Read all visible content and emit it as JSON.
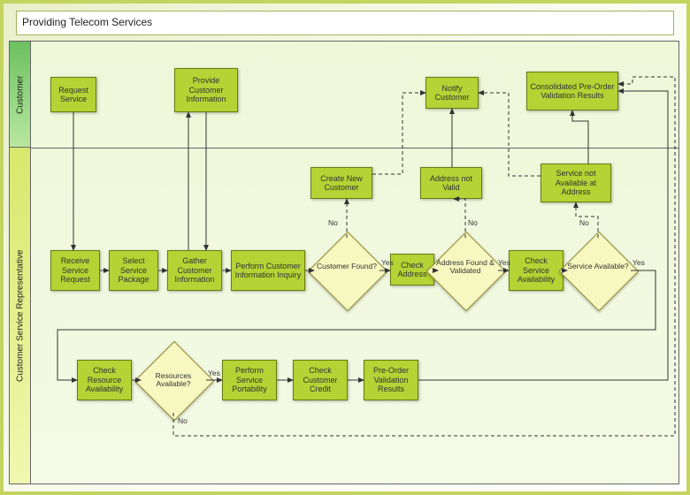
{
  "title": "Providing Telecom Services",
  "lanes": {
    "customer": "Customer",
    "csr": "Customer Service Representative"
  },
  "nodes": {
    "request_service": "Request\nService",
    "provide_ci": "Provide\nCustomer\nInformation",
    "notify_customer": "Notify\nCustomer",
    "consolidated": "Consolidated\nPre-Order\nValidation Results",
    "receive_sr": "Receive\nService\nRequest",
    "select_sp": "Select\nService\nPackage",
    "gather_ci": "Gather\nCustomer\nInformation",
    "perform_cii": "Perform Customer\nInformation\nInquiry",
    "create_nc": "Create New\nCustomer",
    "check_addr": "Check\nAddress",
    "addr_nv": "Address not\nValid",
    "check_sa": "Check\nService\nAvailability",
    "svc_na": "Service not\nAvailable at\nAddress",
    "check_ra": "Check\nResource\nAvailability",
    "perform_sp": "Perform\nService\nPortability",
    "check_cc": "Check\nCustomer\nCredit",
    "preorder_vr": "Pre-Order\nValidation\nResults"
  },
  "decisions": {
    "cust_found": "Customer\nFound?",
    "addr_fv": "Address\nFound &\nValidated",
    "svc_avail": "Service\nAvailable?",
    "res_avail": "Resources\nAvailable?"
  },
  "edge_labels": {
    "yes": "Yes",
    "no": "No"
  },
  "chart_data": {
    "type": "swimlane-flowchart",
    "title": "Providing Telecom Services",
    "lanes": [
      "Customer",
      "Customer Service Representative"
    ],
    "nodes": [
      {
        "id": "request_service",
        "lane": "Customer",
        "type": "process",
        "label": "Request Service"
      },
      {
        "id": "provide_ci",
        "lane": "Customer",
        "type": "process",
        "label": "Provide Customer Information"
      },
      {
        "id": "notify_customer",
        "lane": "Customer",
        "type": "process",
        "label": "Notify Customer"
      },
      {
        "id": "consolidated",
        "lane": "Customer",
        "type": "process",
        "label": "Consolidated Pre-Order Validation Results"
      },
      {
        "id": "receive_sr",
        "lane": "Customer Service Representative",
        "type": "process",
        "label": "Receive Service Request"
      },
      {
        "id": "select_sp",
        "lane": "Customer Service Representative",
        "type": "process",
        "label": "Select Service Package"
      },
      {
        "id": "gather_ci",
        "lane": "Customer Service Representative",
        "type": "process",
        "label": "Gather Customer Information"
      },
      {
        "id": "perform_cii",
        "lane": "Customer Service Representative",
        "type": "process",
        "label": "Perform Customer Information Inquiry"
      },
      {
        "id": "cust_found",
        "lane": "Customer Service Representative",
        "type": "decision",
        "label": "Customer Found?"
      },
      {
        "id": "create_nc",
        "lane": "Customer Service Representative",
        "type": "process",
        "label": "Create New Customer"
      },
      {
        "id": "check_addr",
        "lane": "Customer Service Representative",
        "type": "process",
        "label": "Check Address"
      },
      {
        "id": "addr_fv",
        "lane": "Customer Service Representative",
        "type": "decision",
        "label": "Address Found & Validated"
      },
      {
        "id": "addr_nv",
        "lane": "Customer Service Representative",
        "type": "process",
        "label": "Address not Valid"
      },
      {
        "id": "check_sa",
        "lane": "Customer Service Representative",
        "type": "process",
        "label": "Check Service Availability"
      },
      {
        "id": "svc_avail",
        "lane": "Customer Service Representative",
        "type": "decision",
        "label": "Service Available?"
      },
      {
        "id": "svc_na",
        "lane": "Customer Service Representative",
        "type": "process",
        "label": "Service not Available at Address"
      },
      {
        "id": "check_ra",
        "lane": "Customer Service Representative",
        "type": "process",
        "label": "Check Resource Availability"
      },
      {
        "id": "res_avail",
        "lane": "Customer Service Representative",
        "type": "decision",
        "label": "Resources Available?"
      },
      {
        "id": "perform_sp",
        "lane": "Customer Service Representative",
        "type": "process",
        "label": "Perform Service Portability"
      },
      {
        "id": "check_cc",
        "lane": "Customer Service Representative",
        "type": "process",
        "label": "Check Customer Credit"
      },
      {
        "id": "preorder_vr",
        "lane": "Customer Service Representative",
        "type": "process",
        "label": "Pre-Order Validation Results"
      }
    ],
    "edges": [
      {
        "from": "request_service",
        "to": "receive_sr"
      },
      {
        "from": "receive_sr",
        "to": "select_sp"
      },
      {
        "from": "select_sp",
        "to": "gather_ci"
      },
      {
        "from": "gather_ci",
        "to": "provide_ci"
      },
      {
        "from": "provide_ci",
        "to": "gather_ci"
      },
      {
        "from": "gather_ci",
        "to": "perform_cii"
      },
      {
        "from": "perform_cii",
        "to": "cust_found"
      },
      {
        "from": "cust_found",
        "to": "check_addr",
        "label": "Yes"
      },
      {
        "from": "cust_found",
        "to": "create_nc",
        "label": "No",
        "style": "dashed"
      },
      {
        "from": "create_nc",
        "to": "notify_customer",
        "style": "dashed"
      },
      {
        "from": "check_addr",
        "to": "addr_fv"
      },
      {
        "from": "addr_fv",
        "to": "check_sa",
        "label": "Yes"
      },
      {
        "from": "addr_fv",
        "to": "addr_nv",
        "label": "No",
        "style": "dashed"
      },
      {
        "from": "addr_nv",
        "to": "notify_customer"
      },
      {
        "from": "check_sa",
        "to": "svc_avail"
      },
      {
        "from": "svc_avail",
        "to": "check_ra",
        "label": "Yes"
      },
      {
        "from": "svc_avail",
        "to": "svc_na",
        "label": "No",
        "style": "dashed"
      },
      {
        "from": "svc_na",
        "to": "notify_customer",
        "style": "dashed"
      },
      {
        "from": "svc_na",
        "to": "consolidated"
      },
      {
        "from": "check_ra",
        "to": "res_avail"
      },
      {
        "from": "res_avail",
        "to": "perform_sp",
        "label": "Yes"
      },
      {
        "from": "res_avail",
        "to": "consolidated",
        "label": "No",
        "style": "dashed"
      },
      {
        "from": "perform_sp",
        "to": "check_cc"
      },
      {
        "from": "check_cc",
        "to": "preorder_vr"
      },
      {
        "from": "preorder_vr",
        "to": "consolidated"
      }
    ]
  }
}
